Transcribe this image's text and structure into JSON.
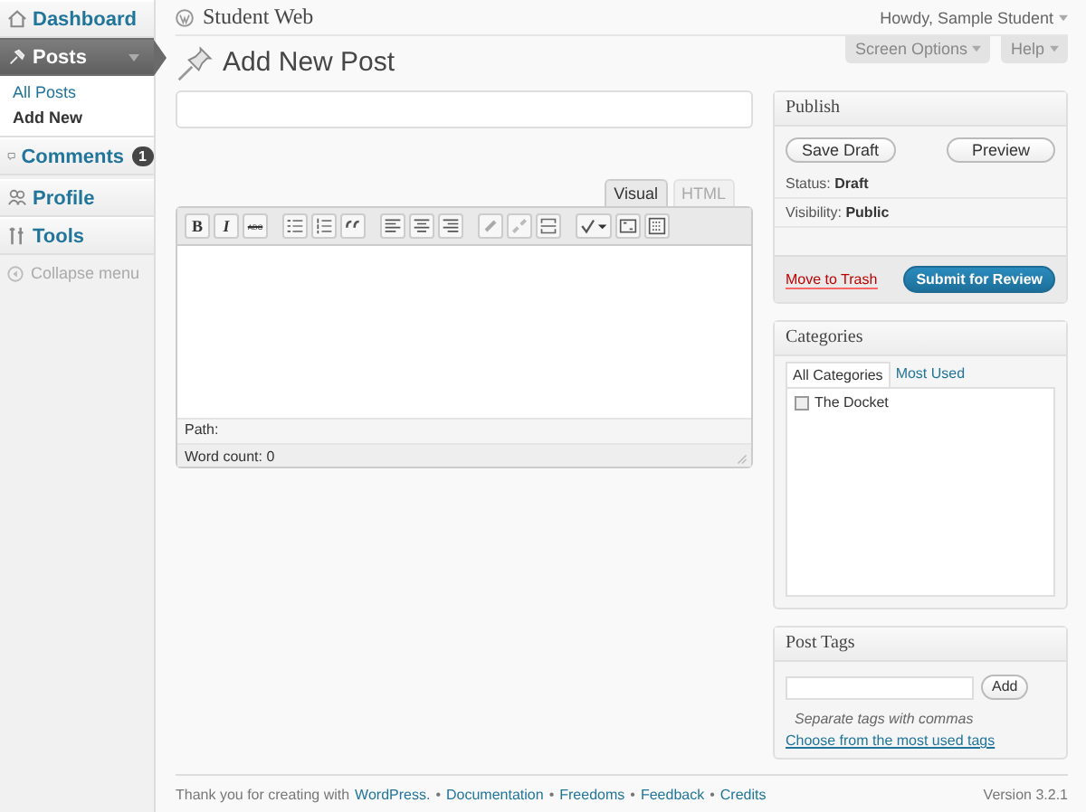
{
  "sidebar": {
    "items": [
      {
        "label": "Dashboard",
        "selected": false
      },
      {
        "label": "Posts",
        "selected": true,
        "expanded": true,
        "children": [
          {
            "label": "All Posts",
            "selected": false
          },
          {
            "label": "Add New",
            "selected": true
          }
        ]
      },
      {
        "label": "Comments",
        "selected": false,
        "badge": "1"
      },
      {
        "label": "Profile",
        "selected": false
      },
      {
        "label": "Tools",
        "selected": false
      }
    ],
    "collapse": "Collapse menu"
  },
  "header": {
    "site": "Student Web",
    "greeting": "Howdy, Sample Student",
    "screen_options": "Screen Options",
    "help": "Help"
  },
  "page_title": "Add New Post",
  "editor": {
    "tabs": [
      {
        "label": "Visual",
        "selected": true
      },
      {
        "label": "HTML",
        "selected": false
      }
    ],
    "toolbar_labels": [
      "B",
      "I",
      "ABC"
    ],
    "path": "Path:",
    "word_count": "Word count: 0"
  },
  "publish": {
    "title": "Publish",
    "save_draft": "Save Draft",
    "preview": "Preview",
    "status_label": "Status:",
    "status": "Draft",
    "visibility_label": "Visibility:",
    "visibility": "Public",
    "trash": "Move to Trash",
    "submit": "Submit for Review"
  },
  "categories": {
    "title": "Categories",
    "tabs": [
      {
        "label": "All Categories",
        "selected": true
      },
      {
        "label": "Most Used",
        "selected": false
      }
    ],
    "items": [
      {
        "label": "The Docket",
        "checked": false
      }
    ]
  },
  "tags": {
    "title": "Post Tags",
    "add": "Add",
    "hint": "Separate tags with commas",
    "link": "Choose from the most used tags"
  },
  "footer": {
    "thanks": "Thank you for creating with",
    "separator": "•",
    "links": [
      "WordPress.",
      "Documentation",
      "Freedoms",
      "Feedback",
      "Credits"
    ],
    "version": "Version 3.2.1"
  }
}
